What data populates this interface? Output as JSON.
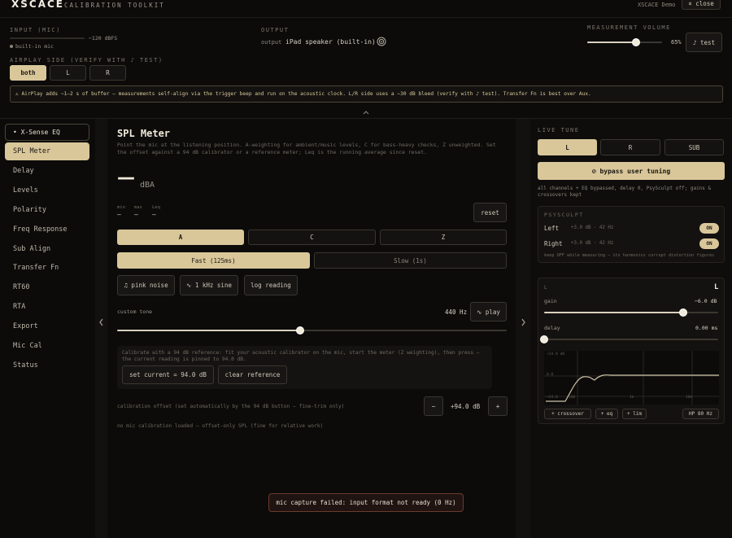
{
  "header": {
    "brand": "XSCACE",
    "subtitle": "CALIBRATION TOOLKIT",
    "demo": "XSCACE Demo",
    "close": "× close"
  },
  "input": {
    "label": "INPUT (MIC)",
    "level": "−120 dBFS",
    "source": "built-in mic"
  },
  "output": {
    "label": "OUTPUT",
    "prefix": "output",
    "device": "iPad speaker (built-in)"
  },
  "measurement_volume": {
    "label": "MEASUREMENT VOLUME",
    "value": "65%",
    "level": 0.65,
    "test": "♪ test"
  },
  "airplay": {
    "label": "AIRPLAY SIDE (VERIFY WITH ♪ TEST)",
    "options": [
      "both",
      "L",
      "R"
    ],
    "selected": "both",
    "notice": "⚠ AirPlay adds ~1–2 s of buffer — measurements self-align via the trigger beep and run on the acoustic clock. L/R side uses a −30 dB bleed (verify with ♪ test). Transfer Fn is best over Aux."
  },
  "sidebar": {
    "top_item": "• X-Sense EQ",
    "items": [
      "SPL Meter",
      "Delay",
      "Levels",
      "Polarity",
      "Freq Response",
      "Sub Align",
      "Transfer Fn",
      "RT60",
      "RTA",
      "Export",
      "Mic Cal",
      "Status"
    ],
    "active": "SPL Meter"
  },
  "spl": {
    "title": "SPL Meter",
    "description": "Point the mic at the listening position. A-weighting for ambient/music levels, C for bass-heavy checks, Z unweighted. Set the offset against a 94 dB calibrator or a reference meter; Leq is the running average since reset.",
    "reading": "—",
    "unit": "dBA",
    "stats_labels": [
      "min",
      "max",
      "Leq"
    ],
    "stats_values": [
      "—",
      "—",
      "—"
    ],
    "reset": "reset",
    "weightings": [
      "A",
      "C",
      "Z"
    ],
    "weighting_selected": "A",
    "responses": [
      "Fast (125ms)",
      "Slow (1s)"
    ],
    "response_selected": "Fast (125ms)",
    "tools": [
      "♫ pink noise",
      "∿ 1 kHz sine",
      "log reading"
    ],
    "custom_tone_label": "custom tone",
    "custom_tone_value": "440 Hz",
    "play": "∿ play",
    "tone_level": 0.47,
    "cal_text": "Calibrate with a 94 dB reference: fit your acoustic calibrator on the mic, start the meter (Z weighting), then press — the current reading is pinned to 94.0 dB.",
    "set_current": "set current = 94.0 dB",
    "clear_reference": "clear reference",
    "offset_label": "calibration offset (set automatically by the 94 dB button — fine-trim only)",
    "offset_minus": "−",
    "offset_value": "+94.0 dB",
    "offset_plus": "+",
    "mic_note": "no mic calibration loaded — offset-only SPL (fine for relative work)",
    "toast": "mic capture failed: input format not ready (0 Hz)"
  },
  "live_tune": {
    "label": "LIVE TUNE",
    "channels": [
      "L",
      "R",
      "SUB"
    ],
    "channel_selected": "L",
    "bypass": "⊘ bypass user tuning",
    "bypass_note": "all channels + EQ bypassed, delay 0, PsySculpt off; gains & crossovers kept",
    "psysculpt": {
      "label": "PSYSCULPT",
      "rows": [
        {
          "name": "Left",
          "detail": "+3.0 dB · 42 Hz",
          "state": "ON"
        },
        {
          "name": "Right",
          "detail": "+3.0 dB · 42 Hz",
          "state": "ON"
        }
      ],
      "note": "keep OFF while measuring — its harmonics corrupt distortion figures"
    },
    "channel": {
      "small_label": "L",
      "big_label": "L",
      "gain_label": "gain",
      "gain_value": "−6.0 dB",
      "gain_level": 0.8,
      "delay_label": "delay",
      "delay_value": "0.00 ms",
      "delay_level": 0.0
    },
    "graph": {
      "y_labels": [
        "+24.0 dB",
        "0.0",
        "−24.0"
      ],
      "x_labels": [
        "100",
        "1k",
        "10k"
      ]
    },
    "chips": [
      "+ crossover",
      "+ eq",
      "+ lim"
    ],
    "hp": "HP 80 Hz"
  }
}
